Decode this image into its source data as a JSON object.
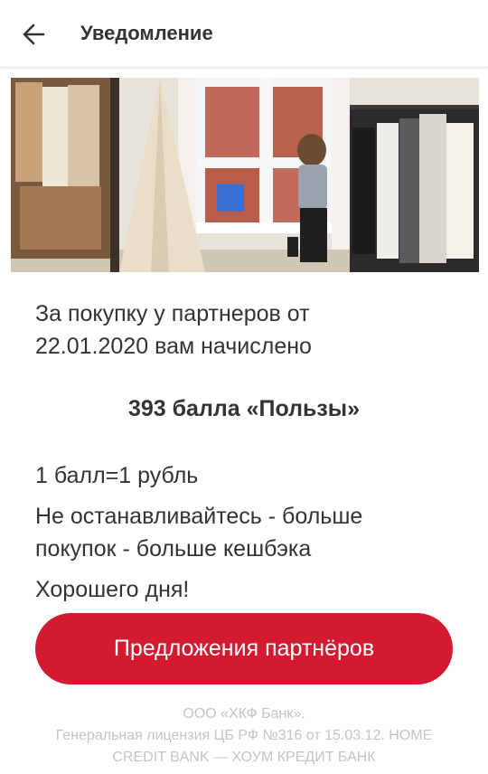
{
  "header": {
    "back_icon": "arrow-left-icon",
    "title": "Уведомление"
  },
  "hero_image": {
    "description_icon": "store-photo"
  },
  "message": {
    "line1": "За покупку у партнеров от",
    "line2": "22.01.2020 вам начислено",
    "points": "393 балла «Пользы»",
    "rate": "1 балл=1 рубль",
    "encourage_line1": "Не останавливайтесь - больше",
    "encourage_line2": "покупок - больше кешбэка",
    "farewell": "Хорошего дня!"
  },
  "cta": {
    "label": "Предложения партнёров",
    "color": "#d41a31"
  },
  "footer": {
    "line1": "ООО «ХКФ Банк».",
    "line2": "Генеральная лицензия ЦБ РФ №316 от 15.03.12. HOME",
    "line3": "CREDIT BANK — ХОУМ КРЕДИТ БАНК"
  }
}
